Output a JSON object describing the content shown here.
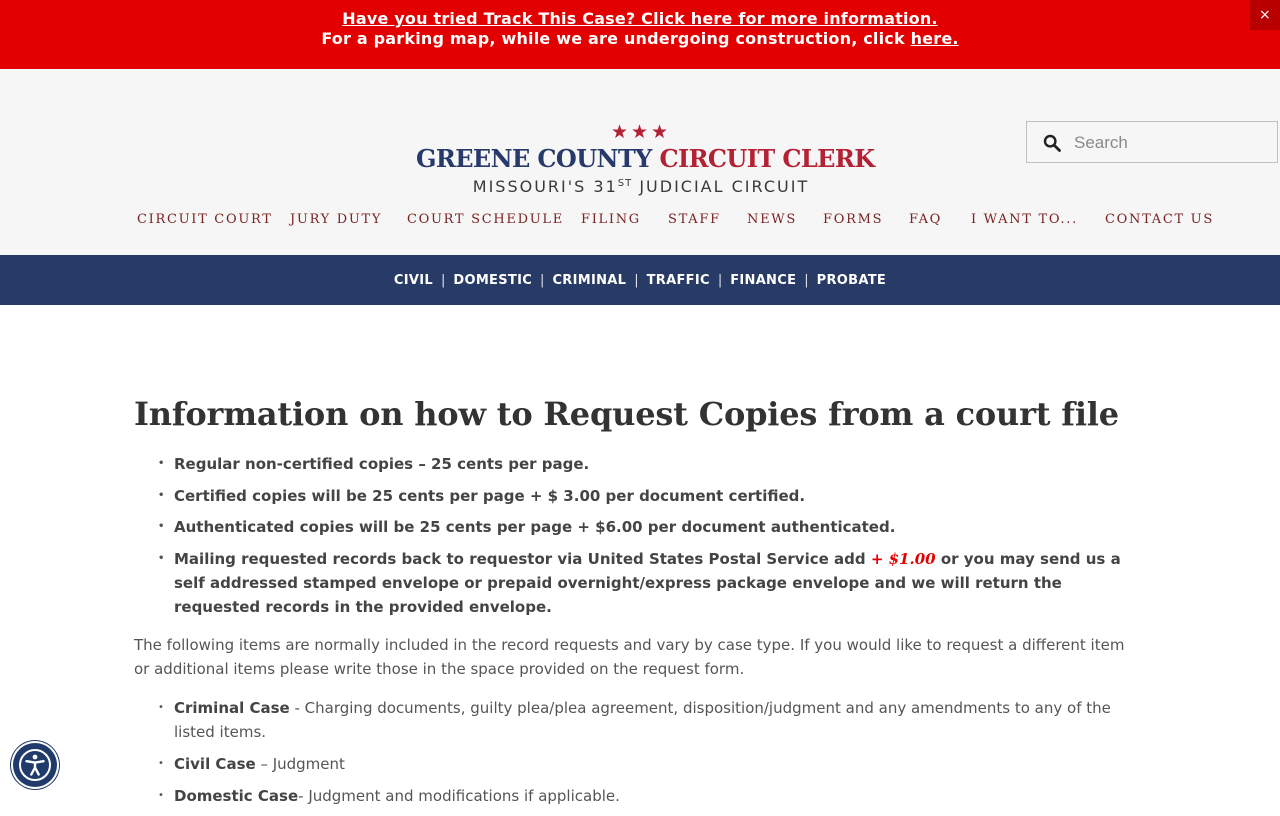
{
  "alert": {
    "line1_link": "Have you tried Track This Case? Click here for more information.",
    "line2_text": "For a parking map, while we are undergoing construction, click ",
    "line2_link": "here.",
    "close_label": "×"
  },
  "logo": {
    "stars": "★★★",
    "name_part1": "GREENE COUNTY ",
    "name_part2": "CIRCUIT CLERK",
    "sub_part1": "MISSOURI'S 31",
    "sub_sup": "ST",
    "sub_part2": " JUDICIAL CIRCUIT"
  },
  "search": {
    "placeholder": "Search"
  },
  "nav": [
    "CIRCUIT COURT",
    "JURY DUTY",
    "COURT SCHEDULE",
    "FILING",
    "STAFF",
    "NEWS",
    "FORMS",
    "FAQ",
    "I WANT TO...",
    "CONTACT US"
  ],
  "subnav": [
    "CIVIL",
    "DOMESTIC",
    "CRIMINAL",
    "TRAFFIC",
    "FINANCE",
    "PROBATE"
  ],
  "subnav_separator": "|",
  "page": {
    "title": "Information on how to Request Copies from a court file",
    "fees": [
      "Regular non-certified copies – 25 cents per page.",
      "Certified copies will be 25 cents per page + $ 3.00 per document certified.",
      "Authenticated copies will be 25 cents per page + $6.00 per document authenticated."
    ],
    "mailing_before": "Mailing requested records back to requestor via United States Postal Service add ",
    "mailing_fee": "+ $1.00",
    "mailing_after": " or you may send us a self addressed stamped envelope or prepaid overnight/express package envelope and we will return the requested records in the provided envelope.",
    "paragraph": "The following items are normally included in the record requests and vary by case type. If you would like to request a different item or additional items please write those in the space provided on the request form.",
    "case_types": [
      {
        "label": "Criminal Case",
        "text": " - Charging documents, guilty plea/plea agreement, disposition/judgment and any amendments to any of the listed items."
      },
      {
        "label": "Civil Case",
        "text": " – Judgment"
      },
      {
        "label": "Domestic Case",
        "text": "- Judgment and modifications if applicable."
      }
    ]
  },
  "colors": {
    "alert_bg": "#e20000",
    "brand_blue": "#283a6b",
    "brand_red": "#b32134",
    "subnav_bg": "#283a66"
  },
  "icons": {
    "search": "search-icon",
    "accessibility": "accessibility-icon",
    "star": "star-icon"
  }
}
